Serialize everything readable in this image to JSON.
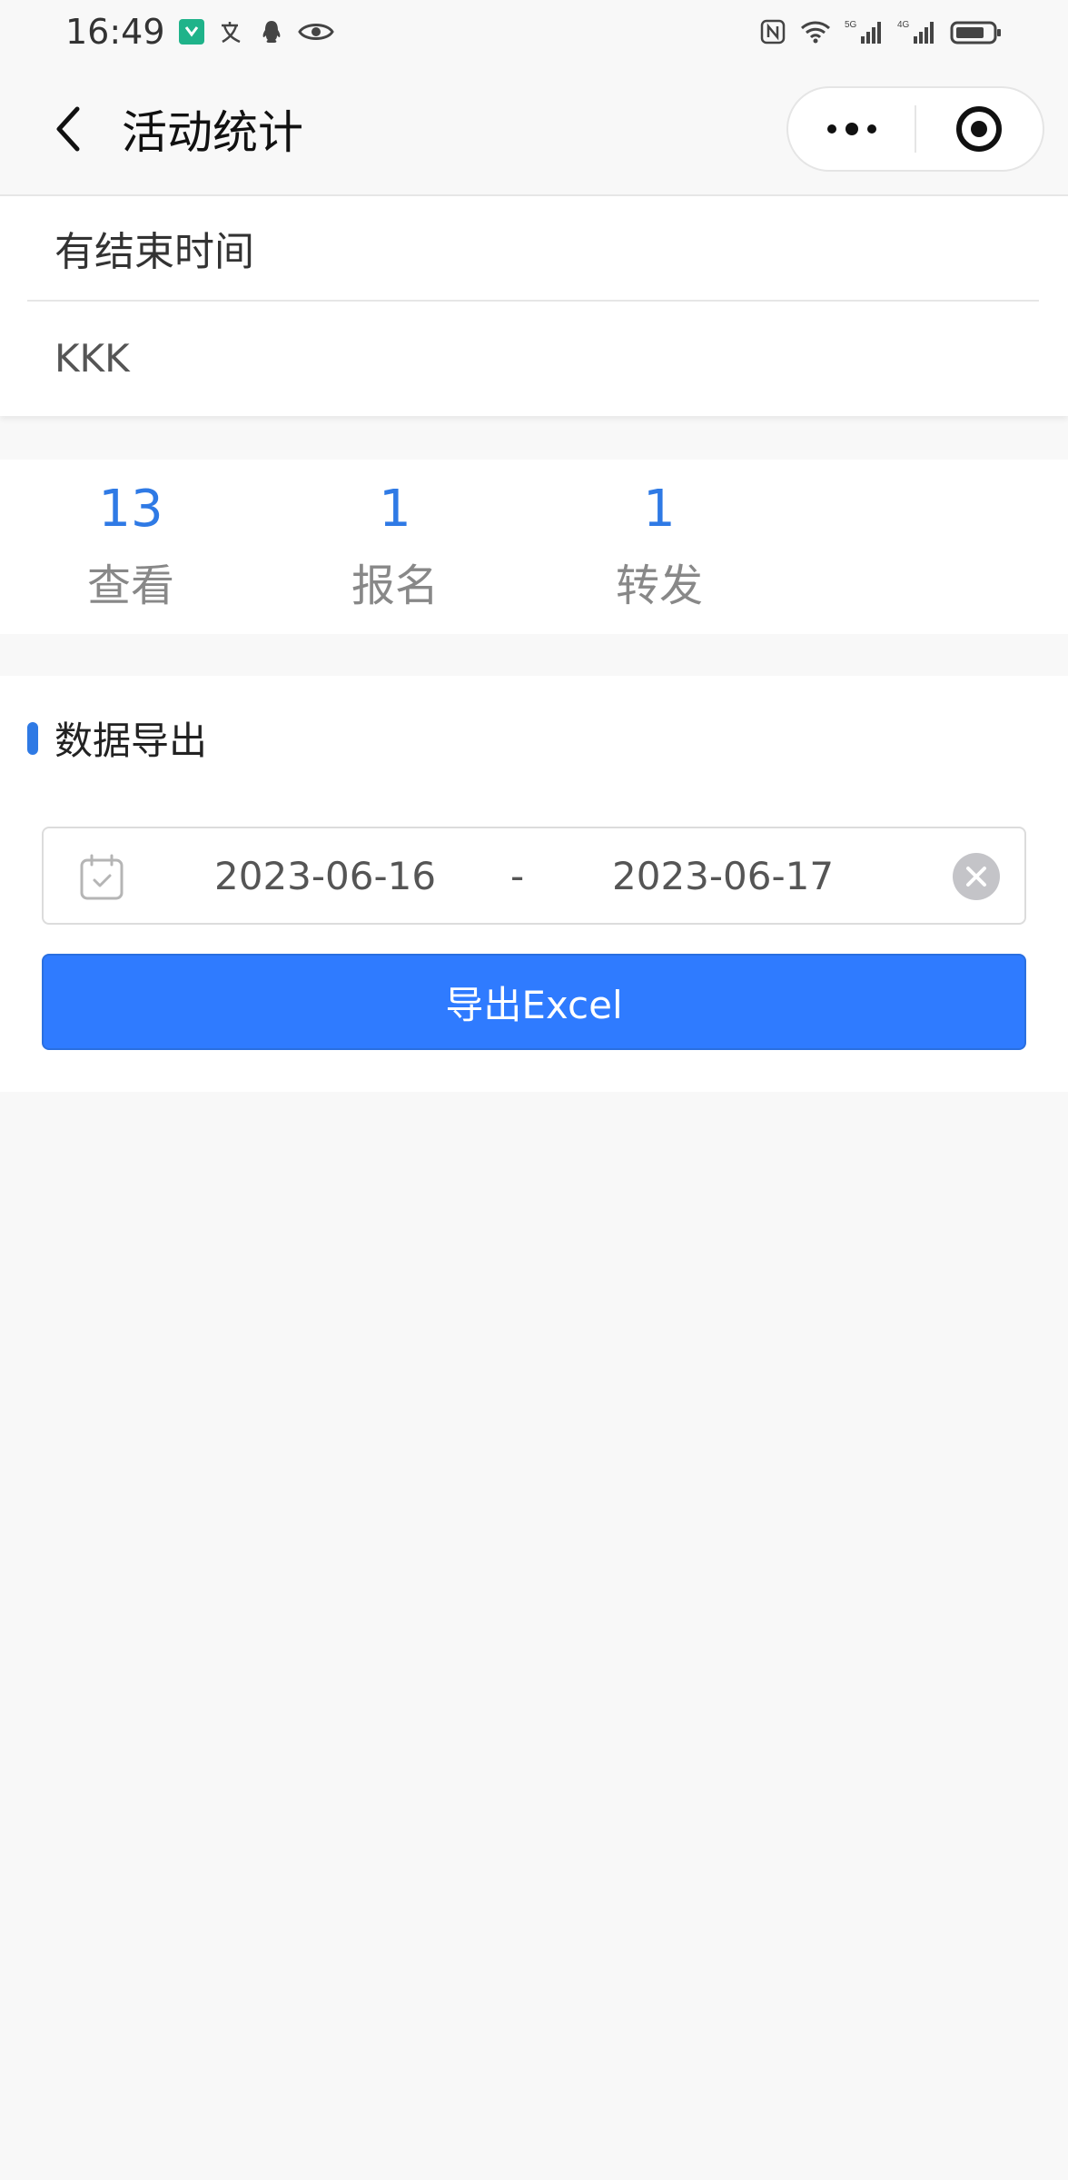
{
  "status_bar": {
    "time": "16:49",
    "icons_left": [
      "app-badge-icon",
      "translate-icon",
      "qq-icon",
      "eye-icon"
    ],
    "icons_right": [
      "nfc-icon",
      "wifi-icon",
      "signal-5g-icon",
      "signal-4g-icon",
      "battery-icon"
    ]
  },
  "navbar": {
    "title": "活动统计",
    "back_icon": "chevron-left-icon",
    "more_icon": "more-dots-icon",
    "close_icon": "target-close-icon"
  },
  "activity": {
    "title": "有结束时间",
    "subtitle": "KKK"
  },
  "stats": [
    {
      "value": "13",
      "label": "查看"
    },
    {
      "value": "1",
      "label": "报名"
    },
    {
      "value": "1",
      "label": "转发"
    }
  ],
  "export": {
    "section_title": "数据导出",
    "date_start": "2023-06-16",
    "date_separator": "-",
    "date_end": "2023-06-17",
    "button_label": "导出Excel"
  },
  "colors": {
    "accent": "#2f7ae5",
    "button": "#2f7bff",
    "background": "#f8f8f8"
  }
}
